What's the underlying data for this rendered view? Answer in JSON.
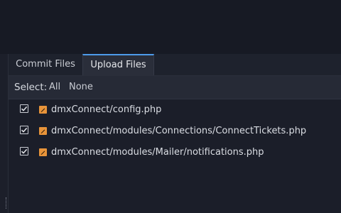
{
  "tabs": [
    {
      "label": "Commit Files",
      "active": false
    },
    {
      "label": "Upload Files",
      "active": true
    }
  ],
  "toolbar": {
    "select_label": "Select:",
    "all_label": "All",
    "none_label": "None"
  },
  "files": [
    {
      "path": "dmxConnect/config.php",
      "checked": true,
      "icon": "php-file-icon"
    },
    {
      "path": "dmxConnect/modules/Connections/ConnectTickets.php",
      "checked": true,
      "icon": "php-file-icon"
    },
    {
      "path": "dmxConnect/modules/Mailer/notifications.php",
      "checked": true,
      "icon": "php-file-icon"
    }
  ],
  "colors": {
    "accent": "#4d9bea",
    "file_icon": "#e8943a",
    "background": "#171a24"
  }
}
